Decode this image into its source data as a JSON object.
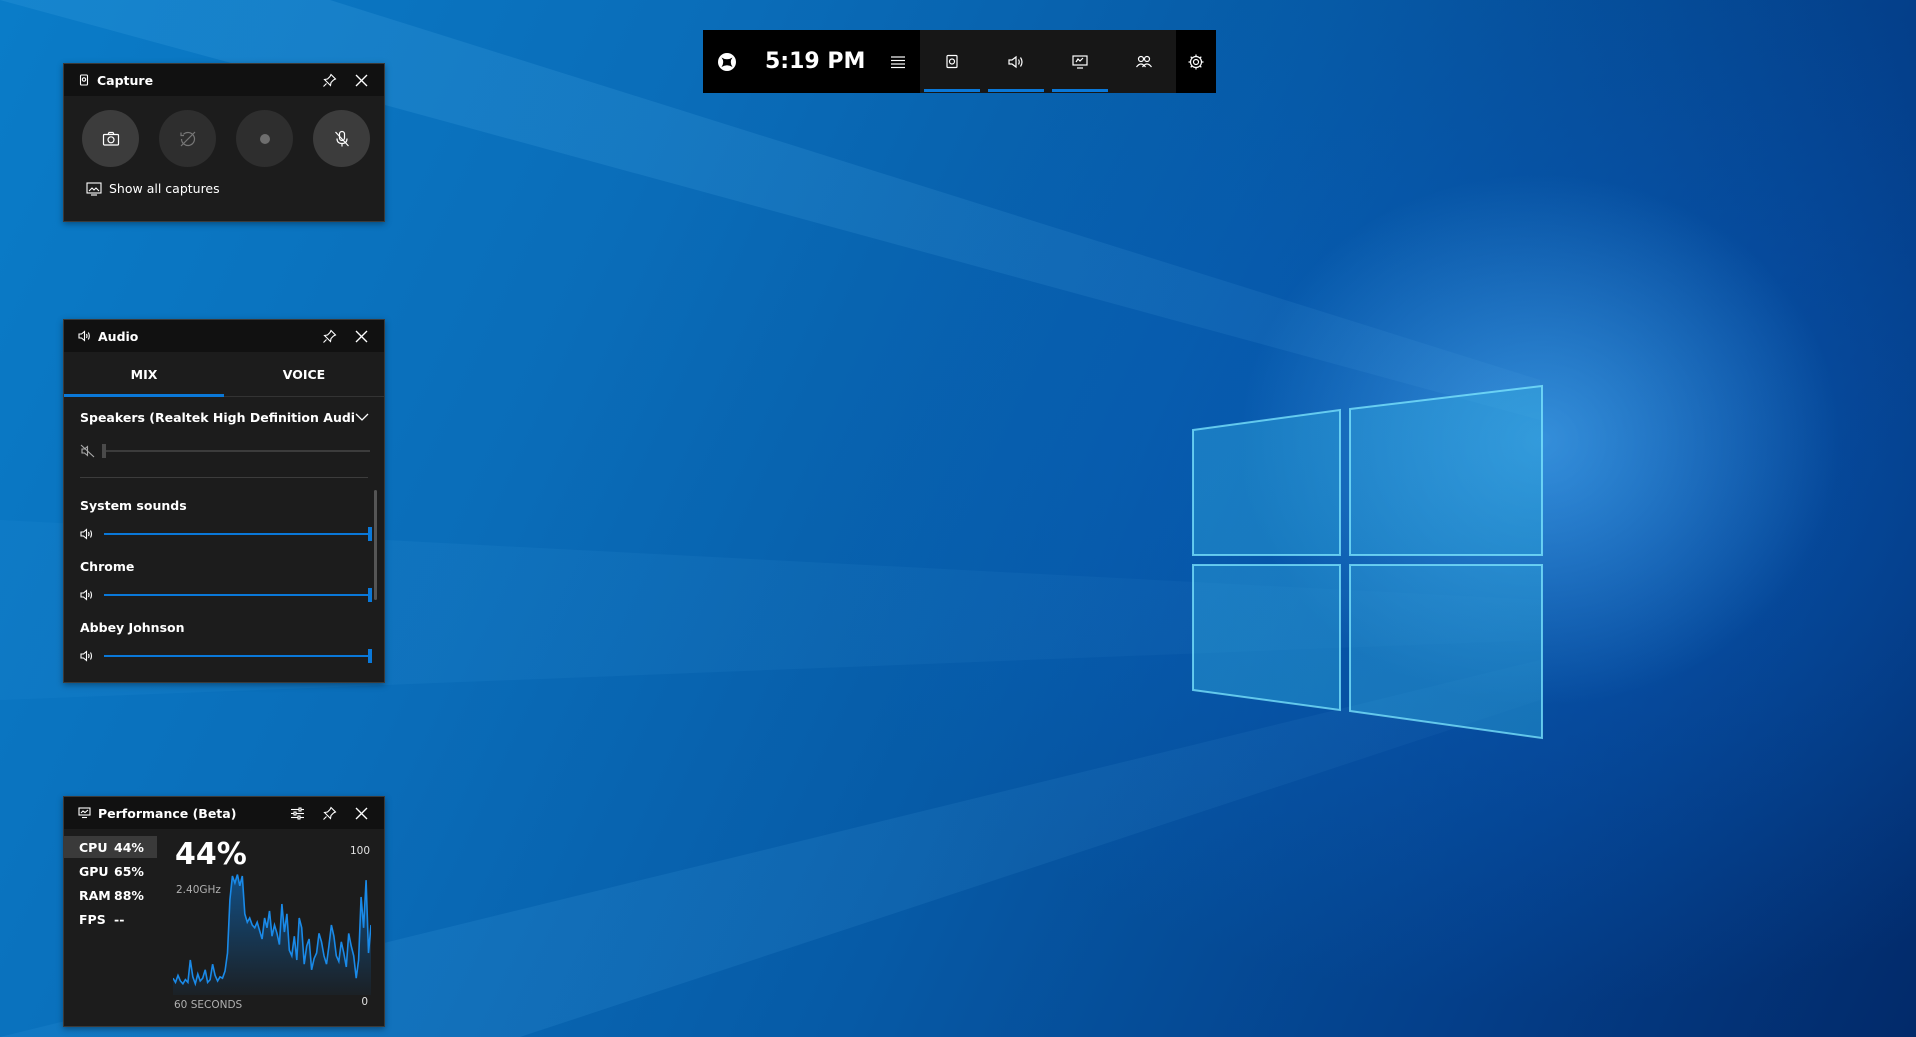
{
  "gamebar": {
    "time": "5:19 PM",
    "icons": [
      "xbox-logo-icon",
      "widget-menu-icon",
      "capture-widget-icon",
      "audio-widget-icon",
      "performance-widget-icon",
      "social-widget-icon",
      "settings-gear-icon"
    ]
  },
  "capture": {
    "title": "Capture",
    "show_all": "Show all captures",
    "buttons": [
      "camera-screenshot-icon",
      "record-last-30s-icon",
      "record-dot-icon",
      "microphone-off-icon"
    ]
  },
  "audio": {
    "title": "Audio",
    "tabs": [
      "MIX",
      "VOICE"
    ],
    "active_tab": "MIX",
    "device": "Speakers (Realtek High Definition Audio(...",
    "master_volume": 0,
    "apps": [
      {
        "name": "System sounds",
        "volume": 100
      },
      {
        "name": "Chrome",
        "volume": 100
      },
      {
        "name": "Abbey Johnson",
        "volume": 100
      }
    ]
  },
  "performance": {
    "title": "Performance (Beta)",
    "stats": [
      {
        "name": "CPU",
        "value": "44%"
      },
      {
        "name": "GPU",
        "value": "65%"
      },
      {
        "name": "RAM",
        "value": "88%"
      },
      {
        "name": "FPS",
        "value": "--"
      }
    ],
    "selected": "CPU",
    "big_value": "44%",
    "sub_value": "2.40GHz",
    "max_label": "100",
    "min_label": "0",
    "time_label": "60 SECONDS",
    "cpu_history": [
      12,
      9,
      14,
      10,
      8,
      11,
      9,
      25,
      13,
      8,
      15,
      10,
      12,
      18,
      9,
      11,
      22,
      14,
      10,
      13,
      12,
      17,
      30,
      68,
      85,
      80,
      86,
      78,
      85,
      58,
      52,
      55,
      50,
      48,
      52,
      46,
      40,
      55,
      48,
      60,
      42,
      50,
      44,
      36,
      65,
      45,
      58,
      32,
      28,
      42,
      25,
      55,
      48,
      22,
      35,
      40,
      18,
      26,
      30,
      44,
      38,
      28,
      22,
      35,
      50,
      42,
      28,
      24,
      38,
      30,
      20,
      44,
      35,
      28,
      12,
      25,
      70,
      48,
      82,
      30,
      50
    ]
  },
  "colors": {
    "accent": "#0a78d8",
    "panel_bg": "#1c1c1c",
    "header_bg": "#111111",
    "desktop_blue": "#0a6db9"
  }
}
